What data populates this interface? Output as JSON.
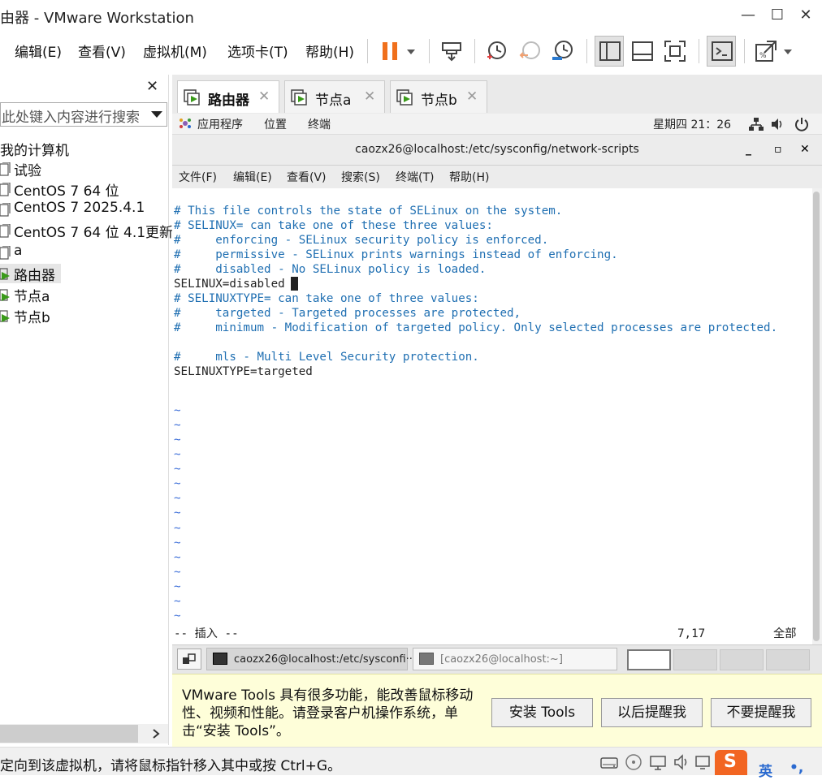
{
  "window": {
    "title": "由器 - VMware Workstation",
    "controls": {
      "minimize": "—",
      "maximize": "☐",
      "close": "✕"
    }
  },
  "menubar": {
    "items": [
      "编辑(E)",
      "查看(V)",
      "虚拟机(M)",
      "选项卡(T)",
      "帮助(H)"
    ]
  },
  "toolbar": {
    "icons": [
      "pause-icon",
      "dropdown-icon",
      "send-keys-icon",
      "snapshot-icon",
      "revert-snapshot-icon",
      "manage-snapshots-icon",
      "library-view-icon",
      "thumbnail-view-icon",
      "fullscreen-icon",
      "console-icon",
      "stretch-icon",
      "dropdown-icon"
    ],
    "accent": "#f0701c"
  },
  "sidebar": {
    "close": "✕",
    "search_placeholder": "此处键入内容进行搜索",
    "root": "我的计算机",
    "items": [
      {
        "label": "试验",
        "kind": "vm-off"
      },
      {
        "label": "CentOS 7 64 位",
        "kind": "vm-off"
      },
      {
        "label": "CentOS 7 2025.4.1",
        "kind": "vm-off"
      },
      {
        "label": "CentOS 7 64 位 4.1更新",
        "kind": "vm-off"
      },
      {
        "label": "a",
        "kind": "vm-off"
      },
      {
        "label": "路由器",
        "kind": "vm-running",
        "selected": true
      },
      {
        "label": "节点a",
        "kind": "vm-running"
      },
      {
        "label": "节点b",
        "kind": "vm-running"
      }
    ]
  },
  "tabs": [
    {
      "label": "路由器",
      "active": true,
      "close": "✕"
    },
    {
      "label": "节点a",
      "active": false,
      "close": "✕"
    },
    {
      "label": "节点b",
      "active": false,
      "close": "✕"
    }
  ],
  "guest_topbar": {
    "menus": [
      "应用程序",
      "位置",
      "终端"
    ],
    "clock": "星期四 21：26"
  },
  "terminal": {
    "title": "caozx26@localhost:/etc/sysconfig/network-scripts",
    "controls": {
      "minimize": "_",
      "maximize": "▫",
      "close": "✕"
    },
    "menus": [
      "文件(F)",
      "编辑(E)",
      "查看(V)",
      "搜索(S)",
      "终端(T)",
      "帮助(H)"
    ],
    "lines": [
      {
        "text": "# This file controls the state of SELinux on the system.",
        "style": "cmt"
      },
      {
        "text": "# SELINUX= can take one of these three values:",
        "style": "cmt"
      },
      {
        "text": "#     enforcing - SELinux security policy is enforced.",
        "style": "cmt"
      },
      {
        "text": "#     permissive - SELinux prints warnings instead of enforcing.",
        "style": "cmt"
      },
      {
        "text": "#     disabled - No SELinux policy is loaded.",
        "style": "cmt"
      },
      {
        "text": "SELINUX=disabled",
        "style": "nrm"
      },
      {
        "text": "# SELINUXTYPE= can take one of three values:",
        "style": "cmt"
      },
      {
        "text": "#     targeted - Targeted processes are protected,",
        "style": "cmt"
      },
      {
        "text": "#     minimum - Modification of targeted policy. Only selected processes are protected.",
        "style": "cmt"
      },
      {
        "text": "",
        "style": "nrm"
      },
      {
        "text": "#     mls - Multi Level Security protection.",
        "style": "cmt"
      },
      {
        "text": "SELINUXTYPE=targeted",
        "style": "nrm"
      }
    ],
    "tilde": "~",
    "tilde_count": 15,
    "mode": "-- 插入 --",
    "position": "7,17",
    "scroll": "全部"
  },
  "guest_taskbar": {
    "items": [
      {
        "label": "caozx26@localhost:/etc/sysconfi···",
        "active": true
      },
      {
        "label": "[caozx26@localhost:~]",
        "active": false
      }
    ]
  },
  "notification": {
    "text": "VMware Tools 具有很多功能，能改善鼠标移动性、视频和性能。请登录客户机操作系统，单击“安装 Tools”。",
    "buttons": [
      "安装 Tools",
      "以后提醒我",
      "不要提醒我"
    ]
  },
  "statusbar": {
    "text": "定向到该虚拟机，请将鼠标指针移入其中或按 Ctrl+G。",
    "ime_label": "英"
  }
}
